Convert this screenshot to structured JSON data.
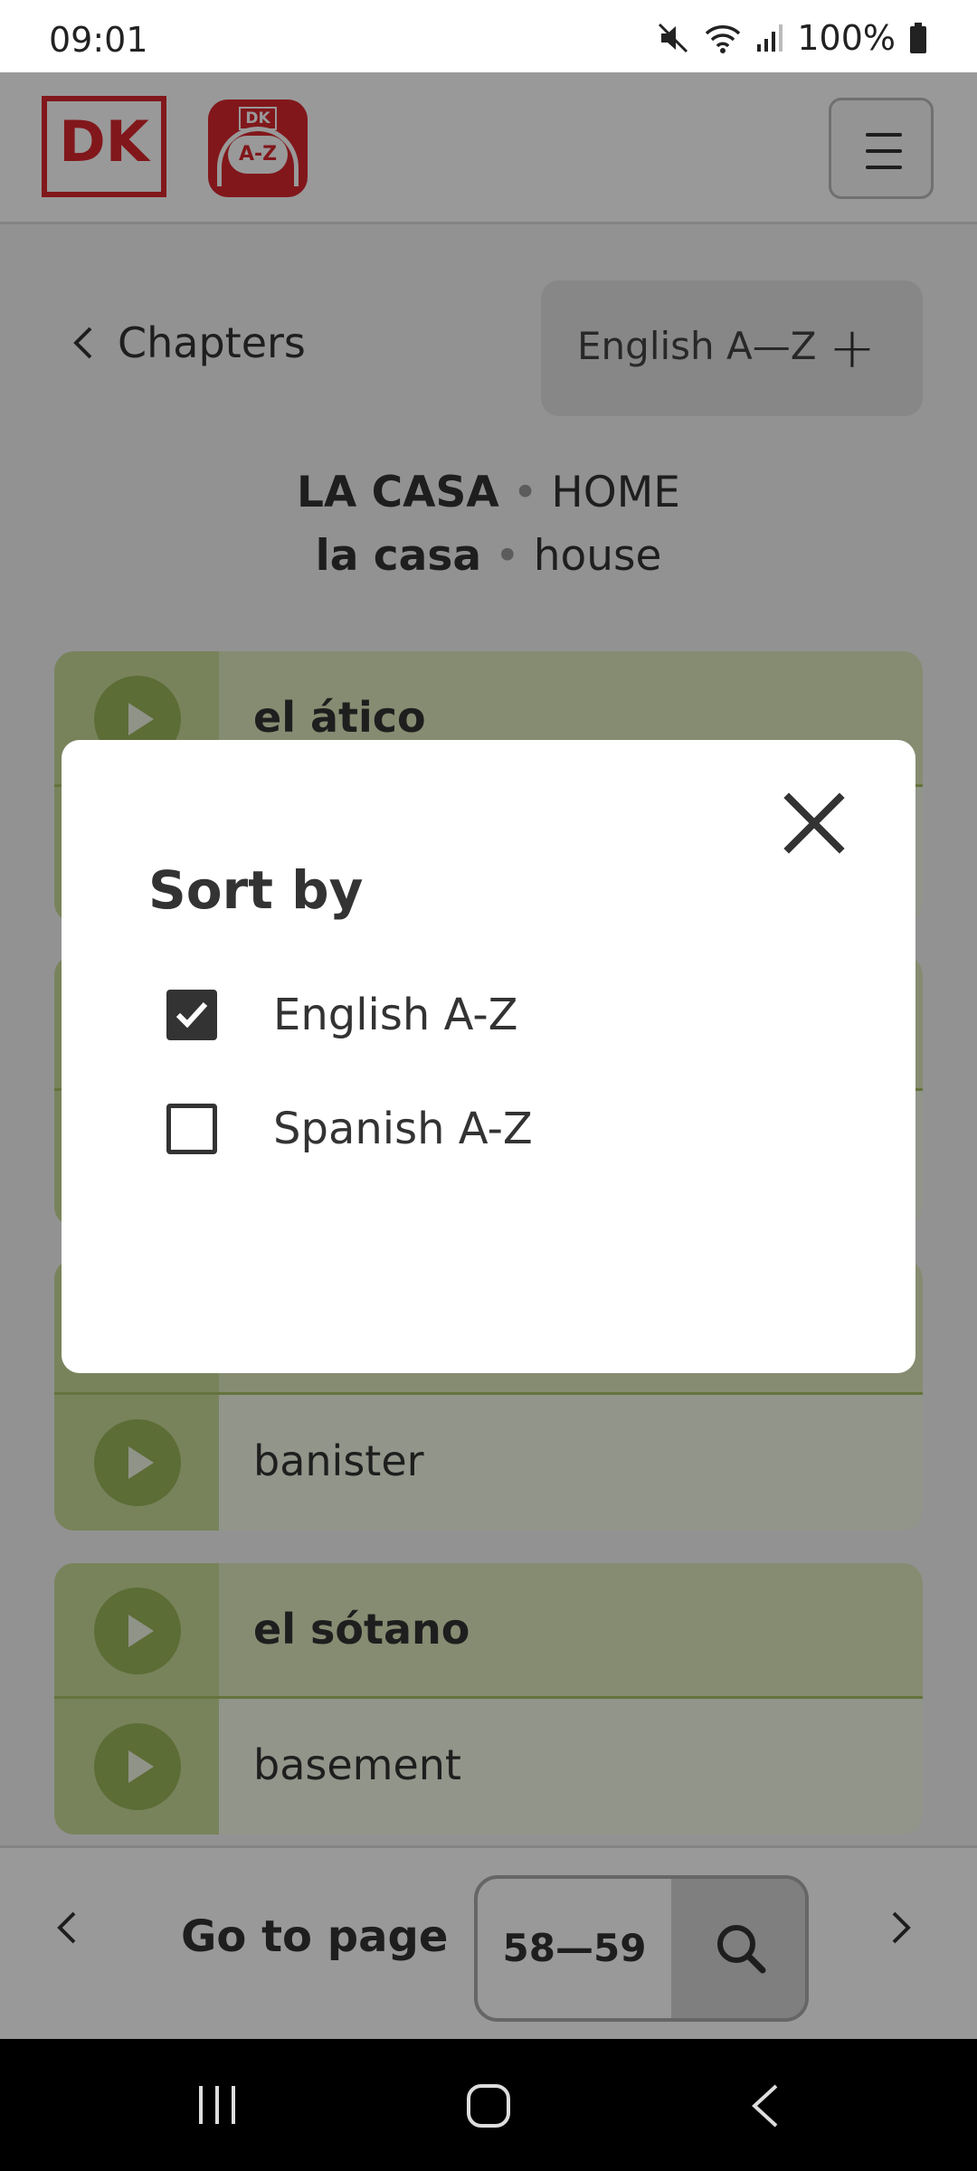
{
  "status_bar": {
    "time": "09:01",
    "battery": "100%"
  },
  "header": {
    "brand_logo": "DK",
    "app_logo_top": "DK",
    "app_logo_main": "A-Z"
  },
  "nav": {
    "back_label": "Chapters",
    "sort_label": "English A—Z"
  },
  "chapter": {
    "es_title": "LA CASA",
    "en_title": "HOME",
    "es_sub": "la casa",
    "en_sub": "house",
    "separator": "•"
  },
  "cards": [
    {
      "spanish": "el ático",
      "english": ""
    },
    {
      "spanish": "",
      "english": ""
    },
    {
      "spanish": "",
      "english": "banister"
    },
    {
      "spanish": "el sótano",
      "english": "basement"
    }
  ],
  "bottom_bar": {
    "goto_label": "Go to page",
    "page_value": "58—59"
  },
  "sort_modal": {
    "title": "Sort by",
    "options": [
      {
        "label": "English A-Z",
        "checked": true
      },
      {
        "label": "Spanish A-Z",
        "checked": false
      }
    ]
  },
  "colors": {
    "brand_red": "#d9272e",
    "card_green": "#c9da9a",
    "play_green": "#9bb65a"
  },
  "icons": [
    "mute-icon",
    "wifi-icon",
    "signal-icon",
    "battery-icon",
    "menu-icon",
    "chevron-left-icon",
    "plus-icon",
    "play-icon",
    "search-icon",
    "chevron-right-icon",
    "close-icon",
    "checkbox-icon",
    "recents-icon",
    "home-icon",
    "back-icon"
  ]
}
